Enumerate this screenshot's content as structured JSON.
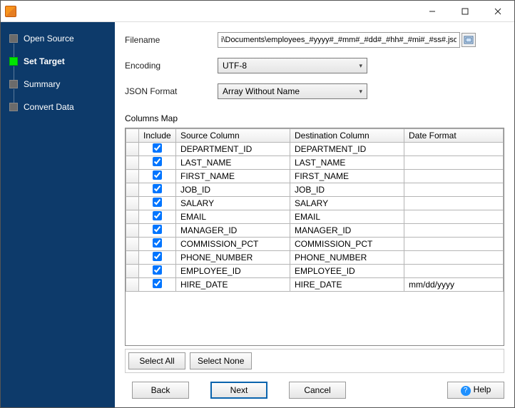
{
  "sidebar": {
    "steps": [
      {
        "label": "Open Source",
        "active": false
      },
      {
        "label": "Set Target",
        "active": true
      },
      {
        "label": "Summary",
        "active": false
      },
      {
        "label": "Convert Data",
        "active": false
      }
    ]
  },
  "form": {
    "filename_label": "Filename",
    "filename_value": "i\\Documents\\employees_#yyyy#_#mm#_#dd#_#hh#_#mi#_#ss#.json",
    "encoding_label": "Encoding",
    "encoding_value": "UTF-8",
    "json_format_label": "JSON Format",
    "json_format_value": "Array Without Name"
  },
  "columns_map_label": "Columns Map",
  "table": {
    "headers": {
      "include": "Include",
      "source": "Source Column",
      "dest": "Destination Column",
      "date": "Date Format"
    },
    "rows": [
      {
        "include": true,
        "src": "DEPARTMENT_ID",
        "dest": "DEPARTMENT_ID",
        "date": ""
      },
      {
        "include": true,
        "src": "LAST_NAME",
        "dest": "LAST_NAME",
        "date": ""
      },
      {
        "include": true,
        "src": "FIRST_NAME",
        "dest": "FIRST_NAME",
        "date": ""
      },
      {
        "include": true,
        "src": "JOB_ID",
        "dest": "JOB_ID",
        "date": ""
      },
      {
        "include": true,
        "src": "SALARY",
        "dest": "SALARY",
        "date": ""
      },
      {
        "include": true,
        "src": "EMAIL",
        "dest": "EMAIL",
        "date": ""
      },
      {
        "include": true,
        "src": "MANAGER_ID",
        "dest": "MANAGER_ID",
        "date": ""
      },
      {
        "include": true,
        "src": "COMMISSION_PCT",
        "dest": "COMMISSION_PCT",
        "date": ""
      },
      {
        "include": true,
        "src": "PHONE_NUMBER",
        "dest": "PHONE_NUMBER",
        "date": ""
      },
      {
        "include": true,
        "src": "EMPLOYEE_ID",
        "dest": "EMPLOYEE_ID",
        "date": ""
      },
      {
        "include": true,
        "src": "HIRE_DATE",
        "dest": "HIRE_DATE",
        "date": "mm/dd/yyyy"
      }
    ]
  },
  "buttons": {
    "select_all": "Select All",
    "select_none": "Select None",
    "back": "Back",
    "next": "Next",
    "cancel": "Cancel",
    "help": "Help"
  }
}
